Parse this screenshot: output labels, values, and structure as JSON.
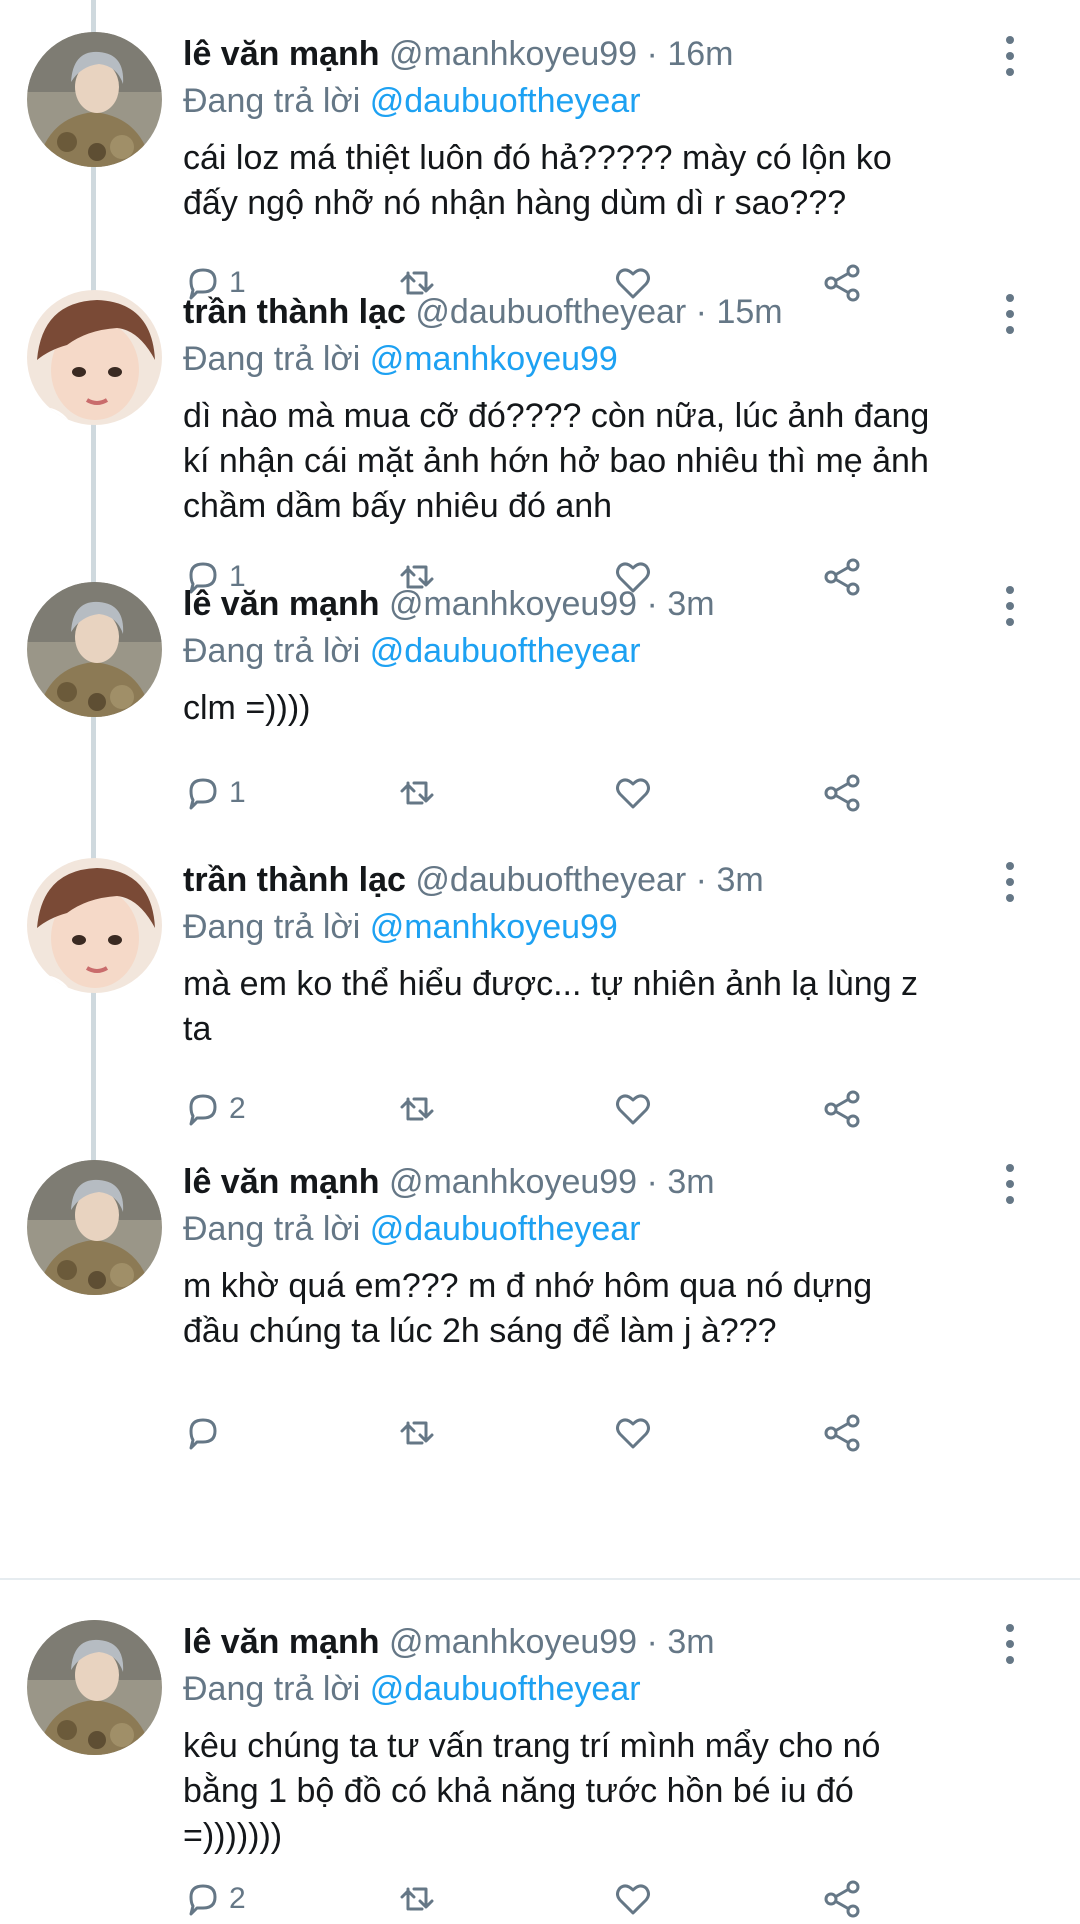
{
  "tweets": [
    {
      "name": "lê văn mạnh",
      "handle": "@manhkoyeu99",
      "dot": "·",
      "time": "16m",
      "reply_prefix": "Đang trả lời",
      "reply_to": "@daubuoftheyear",
      "lines": [
        "cái loz má thiệt luôn đó hả????? mày có lộn ko",
        "đấy ngộ nhỡ nó nhận hàng dùm dì r sao???"
      ],
      "reply_count": "1",
      "avatar": "gray-hair-camo-jacket"
    },
    {
      "name": "trần thành lạc",
      "handle": "@daubuoftheyear",
      "dot": "·",
      "time": "15m",
      "reply_prefix": "Đang trả lời",
      "reply_to": "@manhkoyeu99",
      "lines": [
        "dì nào mà mua cỡ đó???? còn nữa, lúc ảnh đang",
        "kí nhận cái mặt ảnh hớn hở bao nhiêu thì mẹ ảnh",
        "chầm dầm bấy nhiêu đó anh"
      ],
      "reply_count": "1",
      "avatar": "brown-hair-closeup"
    },
    {
      "name": "lê văn mạnh",
      "handle": "@manhkoyeu99",
      "dot": "·",
      "time": "3m",
      "reply_prefix": "Đang trả lời",
      "reply_to": "@daubuoftheyear",
      "lines": [
        "clm =))))"
      ],
      "reply_count": "1",
      "avatar": "gray-hair-camo-jacket"
    },
    {
      "name": "trần thành lạc",
      "handle": "@daubuoftheyear",
      "dot": "·",
      "time": "3m",
      "reply_prefix": "Đang trả lời",
      "reply_to": "@manhkoyeu99",
      "lines": [
        "mà em ko thể hiểu được... tự nhiên ảnh lạ lùng z",
        "ta"
      ],
      "reply_count": "2",
      "avatar": "brown-hair-closeup"
    },
    {
      "name": "lê văn mạnh",
      "handle": "@manhkoyeu99",
      "dot": "·",
      "time": "3m",
      "reply_prefix": "Đang trả lời",
      "reply_to": "@daubuoftheyear",
      "lines": [
        "m khờ quá em??? m đ nhớ hôm qua nó dựng",
        "đầu chúng ta lúc 2h sáng để làm j à???"
      ],
      "reply_count": "",
      "avatar": "gray-hair-camo-jacket"
    },
    {
      "name": "lê văn mạnh",
      "handle": "@manhkoyeu99",
      "dot": "·",
      "time": "3m",
      "reply_prefix": "Đang trả lời",
      "reply_to": "@daubuoftheyear",
      "lines": [
        "kêu chúng ta tư vấn trang trí mình mẩy cho nó",
        "bằng 1 bộ đồ có khả năng tước hồn bé iu đó",
        "=)))))))"
      ],
      "reply_count": "2",
      "avatar": "gray-hair-camo-jacket"
    }
  ],
  "colors": {
    "name": "#14171a",
    "meta": "#657786",
    "link": "#1da1f2",
    "thread_line": "#cfd9de"
  },
  "icons": [
    "reply-icon",
    "retweet-icon",
    "like-icon",
    "share-icon",
    "more-icon"
  ]
}
